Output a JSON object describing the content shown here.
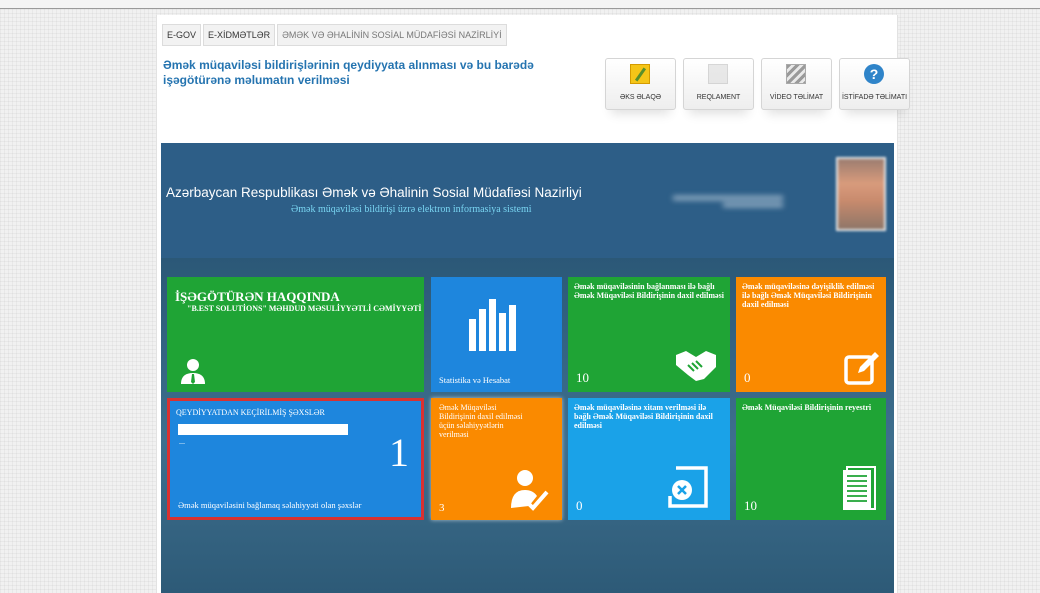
{
  "breadcrumb": [
    "E-GOV",
    "E-XİDMƏTLƏR",
    "ƏMƏK VƏ ƏHALİNİN SOSİAL MÜDAFİƏSİ NAZİRLİYİ"
  ],
  "page_title": "Əmək müqaviləsi bildirişlərinin qeydiyyata alınması və bu barədə işəgötürənə məlumatın verilməsi",
  "toolbar": [
    {
      "label": "ƏKS ƏLAQƏ",
      "icon": "feedback-note-icon"
    },
    {
      "label": "REQLAMENT",
      "icon": "document-icon"
    },
    {
      "label": "VİDEO TƏLİMAT",
      "icon": "clapperboard-icon"
    },
    {
      "label": "İSTİFADƏ TƏLİMATI",
      "icon": "help-icon"
    }
  ],
  "banner": {
    "title": "Azərbaycan Respublikası Əmək və Əhalinin Sosial Müdafiəsi Nazirliyi",
    "subtitle": "Əmək müqaviləsi bildirişi üzrə elektron informasiya sistemi"
  },
  "tiles": {
    "employer": {
      "title": "İŞƏGÖTÜRƏN HAQQINDA",
      "subtitle": "\"B.EST SOLUTİONS\" MƏHDUD MƏSULİYYƏTLİ CƏMİYYƏTİ"
    },
    "stats": {
      "label": "Statistika və Hesabat"
    },
    "contract_new": {
      "title": "Əmək müqaviləsinin bağlanması ilə bağlı Əmək Müqaviləsi Bildirişinin daxil edilməsi",
      "count": "10"
    },
    "contract_change": {
      "title": "Əmək müqaviləsinə dəyişiklik edilməsi ilə bağlı Əmək Müqaviləsi Bildirişinin daxil edilməsi",
      "count": "0"
    },
    "registered_persons": {
      "title": "QEYDİYYATDAN KEÇİRİLMİŞ ŞƏXSLƏR",
      "dots": "...",
      "count": "1",
      "footer": "Əmək müqaviləsini bağlamaq səlahiyyəti olan şəxslər"
    },
    "authority": {
      "title": "Əmək Müqaviləsi Bildirişinin daxil edilməsi üçün səlahiyyətlərin verilməsi",
      "count": "3"
    },
    "termination": {
      "title": "Əmək müqaviləsinə xitam verilməsi ilə bağlı Əmək Müqaviləsi Bildirişinin daxil edilməsi",
      "count": "0"
    },
    "registry": {
      "title": "Əmək Müqaviləsi Bildirişinin reyestri",
      "count": "10"
    }
  },
  "colors": {
    "green": "#1fa435",
    "blue": "#1e86dd",
    "orange": "#fa8a00",
    "cyan": "#1aa2e8",
    "title_blue": "#2574b0",
    "selected_border": "#d93131"
  }
}
